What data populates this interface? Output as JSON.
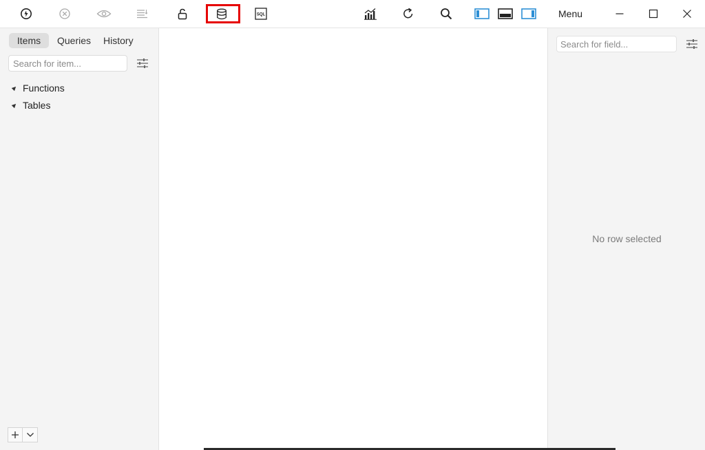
{
  "toolbar": {
    "icons": [
      "connect-icon",
      "close-connection-icon",
      "view-icon",
      "list-icon",
      "lock-icon",
      "database-icon",
      "sql-icon",
      "chart-icon",
      "refresh-icon",
      "search-icon",
      "toggle-left-panel-icon",
      "toggle-bottom-panel-icon",
      "toggle-right-panel-icon"
    ],
    "sql_text": "SQL",
    "menu_label": "Menu",
    "highlight_color": "#e60000",
    "panel_accent": "#2d8fd5"
  },
  "left_panel": {
    "tabs": [
      {
        "label": "Items"
      },
      {
        "label": "Queries"
      },
      {
        "label": "History"
      }
    ],
    "search_placeholder": "Search for item...",
    "tree": [
      {
        "label": "Functions"
      },
      {
        "label": "Tables"
      }
    ]
  },
  "right_panel": {
    "search_placeholder": "Search for field...",
    "empty_message": "No row selected"
  }
}
